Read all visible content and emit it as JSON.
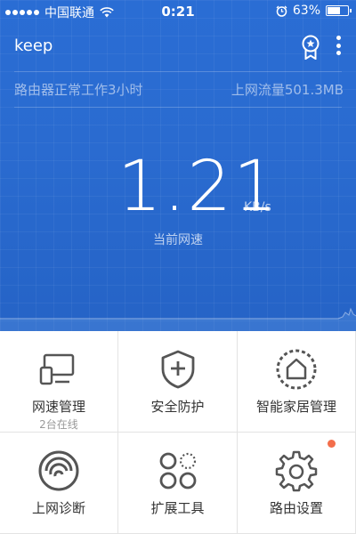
{
  "status_bar": {
    "carrier": "中国联通",
    "time": "0:21",
    "battery": "63%",
    "battery_level": 0.63
  },
  "app_bar": {
    "title": "keep",
    "badge_icon": "award-ribbon-icon",
    "more_icon": "more-vertical-icon"
  },
  "info_row": {
    "uptime": "路由器正常工作3小时",
    "traffic": "上网流量501.3MB"
  },
  "speed": {
    "value": "1.21",
    "unit": "KB/s",
    "label": "当前网速"
  },
  "colors": {
    "primary": "#2a6dd4",
    "notification_dot": "#f36e4b",
    "tile_text": "#333333"
  },
  "tiles": [
    {
      "label": "网速管理",
      "sub": "2台在线",
      "icon": "devices-icon"
    },
    {
      "label": "安全防护",
      "icon": "shield-plus-icon"
    },
    {
      "label": "智能家居管理",
      "icon": "smart-home-icon"
    },
    {
      "label": "上网诊断",
      "icon": "diagnose-icon"
    },
    {
      "label": "扩展工具",
      "icon": "extend-tools-icon"
    },
    {
      "label": "路由设置",
      "icon": "gear-icon",
      "has_notification": true
    }
  ]
}
